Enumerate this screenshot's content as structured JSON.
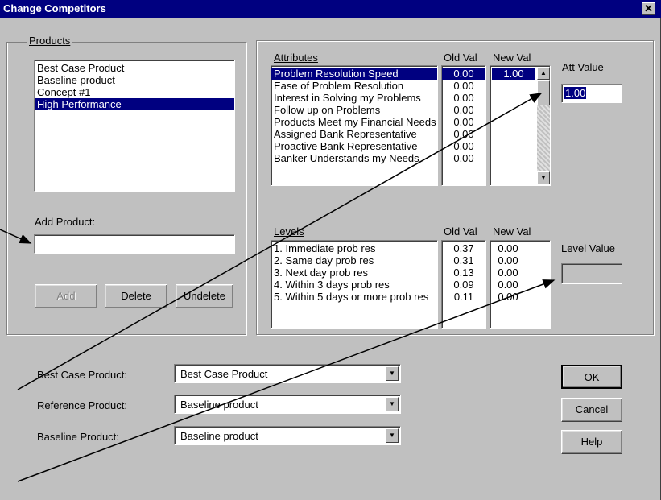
{
  "window": {
    "title": "Change Competitors",
    "close_glyph": "✕"
  },
  "products": {
    "group_label": "Products",
    "items": [
      "Best Case Product",
      "Baseline product",
      "Concept #1",
      "High Performance"
    ],
    "selected_index": 3
  },
  "add_product": {
    "label": "Add Product:",
    "value": ""
  },
  "buttons": {
    "add": "Add",
    "delete": "Delete",
    "undelete": "Undelete"
  },
  "attributes": {
    "header": "Attributes",
    "old_header": "Old Val",
    "new_header": "New Val",
    "items": [
      "Problem Resolution Speed",
      "Ease of Problem Resolution",
      "Interest in Solving my Problems",
      "Follow up on Problems",
      "Products Meet my Financial Needs",
      "Assigned Bank Representative",
      "Proactive Bank Representative",
      "Banker Understands my Needs"
    ],
    "old_values": [
      "0.00",
      "0.00",
      "0.00",
      "0.00",
      "0.00",
      "0.00",
      "0.00",
      "0.00"
    ],
    "new_values": [
      "1.00"
    ],
    "att_value_label": "Att Value",
    "att_value": "1.00"
  },
  "levels": {
    "header": "Levels",
    "old_header": "Old Val",
    "new_header": "New Val",
    "items": [
      "1. Immediate prob res",
      "2. Same day prob res",
      "3. Next day prob res",
      "4. Within 3 days prob res",
      "5. Within 5 days or more prob res"
    ],
    "old_values": [
      "0.37",
      "0.31",
      "0.13",
      "0.09",
      "0.11"
    ],
    "new_values": [
      "0.00",
      "0.00",
      "0.00",
      "0.00",
      "0.00"
    ],
    "level_value_label": "Level Value",
    "level_value": ""
  },
  "dropdowns": [
    {
      "label": "Best Case Product:",
      "value": "Best Case Product"
    },
    {
      "label": "Reference Product:",
      "value": "Baseline product"
    },
    {
      "label": "Baseline Product:",
      "value": "Baseline product"
    }
  ],
  "dialog_buttons": {
    "ok": "OK",
    "cancel": "Cancel",
    "help": "Help"
  }
}
